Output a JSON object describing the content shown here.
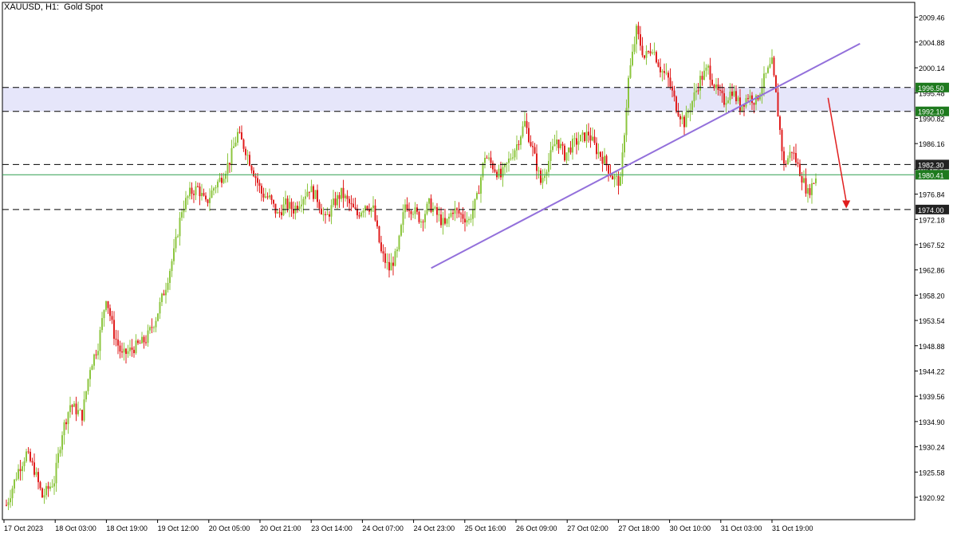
{
  "title": "XAUUSD, H1:  Gold Spot",
  "colors": {
    "bull": "#8cc63f",
    "bear": "#e01e1e",
    "zone": "#e6e6fa",
    "trendline": "#9370db",
    "current_line": "#2e9e4e",
    "level_line": "#000000",
    "arrow": "#e01e1e",
    "label_green": "#1e7a1e",
    "label_black": "#222222"
  },
  "chart_data": {
    "type": "candlestick",
    "symbol": "XAUUSD",
    "timeframe": "H1",
    "ylim": [
      1916.8,
      2012.2
    ],
    "y_ticks": [
      "2009.46",
      "2004.88",
      "2000.14",
      "1995.48",
      "1990.82",
      "1986.16",
      "1981.42",
      "1976.84",
      "1972.18",
      "1967.52",
      "1962.86",
      "1958.20",
      "1953.54",
      "1948.88",
      "1944.22",
      "1939.56",
      "1934.90",
      "1930.24",
      "1925.58",
      "1920.92"
    ],
    "x_labels": [
      "17 Oct 2023",
      "18 Oct 03:00",
      "18 Oct 19:00",
      "19 Oct 12:00",
      "20 Oct 05:00",
      "20 Oct 21:00",
      "23 Oct 14:00",
      "24 Oct 07:00",
      "24 Oct 23:00",
      "25 Oct 16:00",
      "26 Oct 09:00",
      "27 Oct 02:00",
      "27 Oct 18:00",
      "30 Oct 10:00",
      "31 Oct 03:00",
      "31 Oct 19:00"
    ],
    "levels": [
      {
        "value": 1996.5,
        "label": "1996.50",
        "style": "dashed",
        "label_color": "green"
      },
      {
        "value": 1992.1,
        "label": "1992.10",
        "style": "dashed",
        "label_color": "green"
      },
      {
        "value": 1982.3,
        "label": "1982.30",
        "style": "dashed",
        "label_color": "black"
      },
      {
        "value": 1980.41,
        "label": "1980.41",
        "style": "solid",
        "label_color": "green"
      },
      {
        "value": 1974.0,
        "label": "1974.00",
        "style": "dashed",
        "label_color": "black"
      }
    ],
    "zone": [
      1992.1,
      1996.5
    ],
    "trendline": {
      "from": {
        "bar": 0.47,
        "price": 1963.2
      },
      "to": {
        "bar": 0.94,
        "price": 2004.6
      }
    },
    "forecast_arrow": {
      "from": {
        "bar": 0.905,
        "price": 1994.6
      },
      "to": {
        "bar": 0.925,
        "price": 1974.2
      }
    },
    "close_path": [
      [
        0,
        1919.5
      ],
      [
        6,
        1926
      ],
      [
        10,
        1929
      ],
      [
        14,
        1926
      ],
      [
        18,
        1921
      ],
      [
        24,
        1924
      ],
      [
        28,
        1933
      ],
      [
        32,
        1938
      ],
      [
        38,
        1936
      ],
      [
        42,
        1945
      ],
      [
        46,
        1949
      ],
      [
        50,
        1958
      ],
      [
        54,
        1951
      ],
      [
        58,
        1947
      ],
      [
        62,
        1948
      ],
      [
        66,
        1949
      ],
      [
        70,
        1950
      ],
      [
        75,
        1954
      ],
      [
        80,
        1960
      ],
      [
        84,
        1966
      ],
      [
        88,
        1974
      ],
      [
        92,
        1977
      ],
      [
        96,
        1978
      ],
      [
        100,
        1975
      ],
      [
        104,
        1978
      ],
      [
        108,
        1980
      ],
      [
        112,
        1983
      ],
      [
        116,
        1988
      ],
      [
        120,
        1985
      ],
      [
        124,
        1981
      ],
      [
        128,
        1977
      ],
      [
        132,
        1976
      ],
      [
        136,
        1973
      ],
      [
        140,
        1975
      ],
      [
        144,
        1974
      ],
      [
        148,
        1976
      ],
      [
        152,
        1978
      ],
      [
        156,
        1976
      ],
      [
        160,
        1972
      ],
      [
        164,
        1975
      ],
      [
        168,
        1977
      ],
      [
        172,
        1975
      ],
      [
        176,
        1973
      ],
      [
        180,
        1975
      ],
      [
        184,
        1974
      ],
      [
        188,
        1966
      ],
      [
        192,
        1963
      ],
      [
        196,
        1966
      ],
      [
        200,
        1975
      ],
      [
        204,
        1974
      ],
      [
        208,
        1972
      ],
      [
        212,
        1975
      ],
      [
        216,
        1973
      ],
      [
        220,
        1971
      ],
      [
        224,
        1974
      ],
      [
        228,
        1973
      ],
      [
        232,
        1972
      ],
      [
        236,
        1976
      ],
      [
        240,
        1984
      ],
      [
        244,
        1982
      ],
      [
        248,
        1980
      ],
      [
        252,
        1983
      ],
      [
        256,
        1986
      ],
      [
        260,
        1990
      ],
      [
        264,
        1985
      ],
      [
        268,
        1979
      ],
      [
        272,
        1983
      ],
      [
        276,
        1987
      ],
      [
        280,
        1984
      ],
      [
        284,
        1986
      ],
      [
        288,
        1987
      ],
      [
        292,
        1988
      ],
      [
        296,
        1985
      ],
      [
        300,
        1983
      ],
      [
        304,
        1980
      ],
      [
        308,
        1979
      ],
      [
        312,
        1998
      ],
      [
        316,
        2007
      ],
      [
        320,
        2002
      ],
      [
        324,
        2004
      ],
      [
        328,
        2000
      ],
      [
        332,
        1998
      ],
      [
        336,
        1993
      ],
      [
        340,
        1990
      ],
      [
        344,
        1994
      ],
      [
        348,
        1998
      ],
      [
        352,
        2000
      ],
      [
        356,
        1996
      ],
      [
        360,
        1994
      ],
      [
        364,
        1996
      ],
      [
        368,
        1993
      ],
      [
        372,
        1995
      ],
      [
        376,
        1994
      ],
      [
        380,
        1998
      ],
      [
        384,
        2001
      ],
      [
        386,
        1995
      ],
      [
        390,
        1982
      ],
      [
        394,
        1985
      ],
      [
        398,
        1981
      ],
      [
        402,
        1977
      ],
      [
        406,
        1980
      ]
    ]
  }
}
